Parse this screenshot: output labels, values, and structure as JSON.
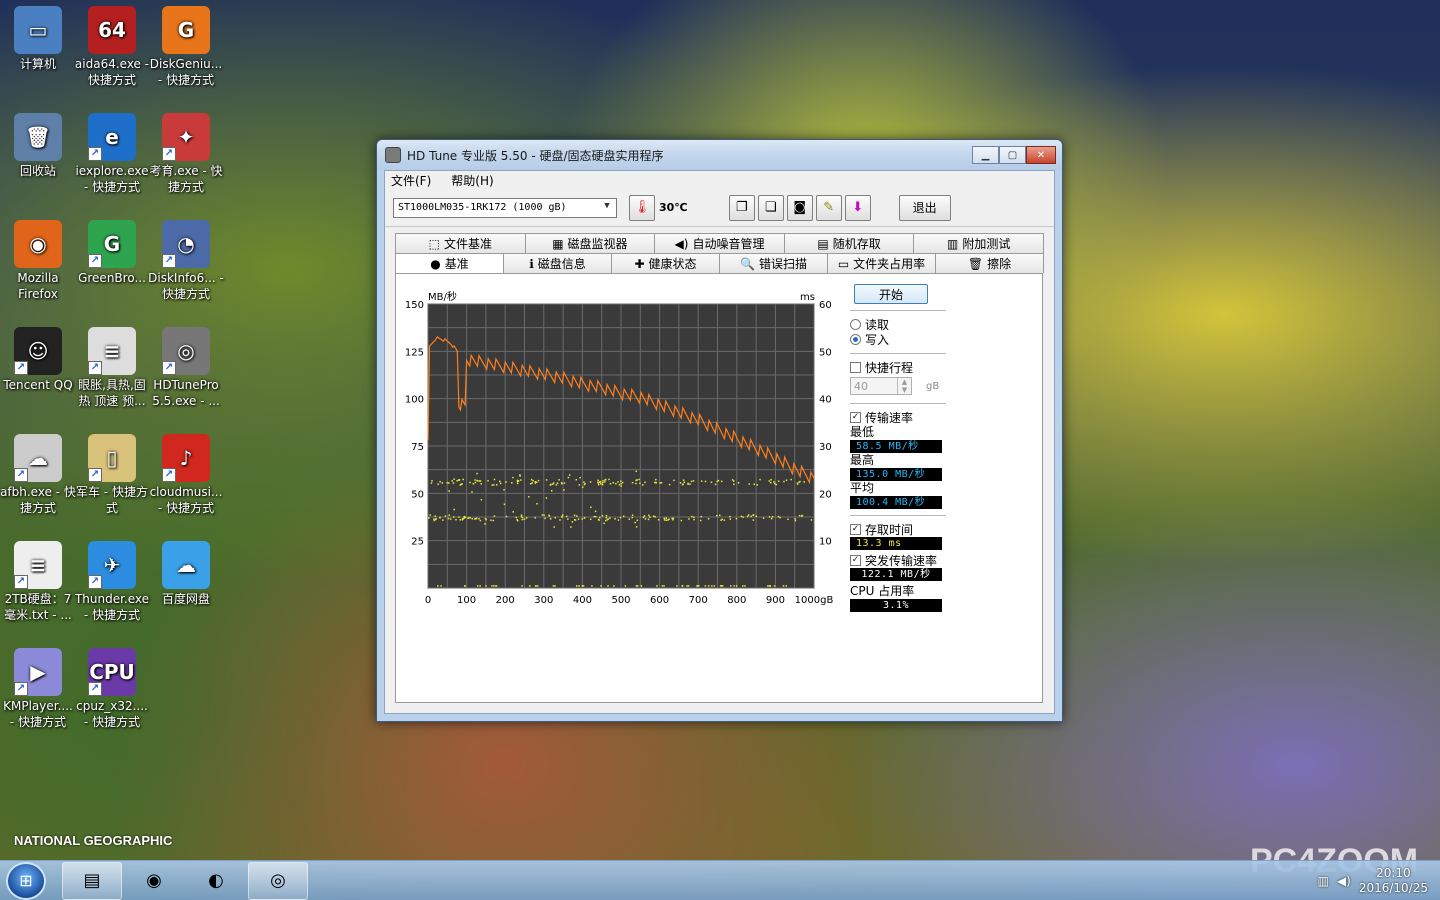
{
  "desktop": {
    "icons": [
      {
        "label": "计算机",
        "glyph": "▭",
        "color": "#4a7fc1"
      },
      {
        "label": "aida64.exe - 快捷方式",
        "glyph": "64",
        "color": "#b41f1f"
      },
      {
        "label": "DiskGeniu... - 快捷方式",
        "glyph": "G",
        "color": "#e8751a"
      },
      {
        "label": "回收站",
        "glyph": "🗑",
        "color": "#5d7fa8"
      },
      {
        "label": "iexplore.exe - 快捷方式",
        "glyph": "e",
        "color": "#1e6fc9"
      },
      {
        "label": "考育.exe - 快捷方式",
        "glyph": "✦",
        "color": "#c93a3a"
      },
      {
        "label": "Mozilla Firefox",
        "glyph": "◉",
        "color": "#e0641a"
      },
      {
        "label": "GreenBro...",
        "glyph": "G",
        "color": "#2ea44f"
      },
      {
        "label": "DiskInfo6... - 快捷方式",
        "glyph": "◔",
        "color": "#4c6aa8"
      },
      {
        "label": "Tencent QQ",
        "glyph": "☺",
        "color": "#222222"
      },
      {
        "label": "眼胀,具热,固热 顶速 预...",
        "glyph": "≡",
        "color": "#dddddd"
      },
      {
        "label": "HDTunePro 5.5.exe - ...",
        "glyph": "◎",
        "color": "#777777"
      },
      {
        "label": "afbh.exe - 快捷方式",
        "glyph": "☁",
        "color": "#cccccc"
      },
      {
        "label": "军车 - 快捷方式",
        "glyph": "▯",
        "color": "#d9c27a"
      },
      {
        "label": "cloudmusi... - 快捷方式",
        "glyph": "♪",
        "color": "#d0281e"
      },
      {
        "label": "2TB硬盘：7毫米.txt - ...",
        "glyph": "≡",
        "color": "#eeeeee"
      },
      {
        "label": "Thunder.exe - 快捷方式",
        "glyph": "✈",
        "color": "#2c8de0"
      },
      {
        "label": "百度网盘",
        "glyph": "☁",
        "color": "#3aa0e8"
      },
      {
        "label": "KMPlayer.... - 快捷方式",
        "glyph": "▶",
        "color": "#8a8ad8"
      },
      {
        "label": "cpuz_x32.... - 快捷方式",
        "glyph": "CPU",
        "color": "#6a3aa8"
      }
    ],
    "natgeo": "NATIONAL GEOGRAPHIC",
    "watermark": "PC4ZOOM"
  },
  "window": {
    "title": "HD Tune 专业版 5.50 - 硬盘/固态硬盘实用程序",
    "menu": {
      "file": "文件(F)",
      "help": "帮助(H)"
    },
    "drive": "ST1000LM035-1RK172 (1000 gB)",
    "temperature": "30℃",
    "exit_label": "退出",
    "tabs_row1": [
      {
        "label": "文件基准",
        "icon": "⬚"
      },
      {
        "label": "磁盘监视器",
        "icon": "▦"
      },
      {
        "label": "自动噪音管理",
        "icon": "◀)"
      },
      {
        "label": "随机存取",
        "icon": "▤"
      },
      {
        "label": "附加测试",
        "icon": "▥"
      }
    ],
    "tabs_row2": [
      {
        "label": "基准",
        "icon": "●"
      },
      {
        "label": "磁盘信息",
        "icon": "ℹ"
      },
      {
        "label": "健康状态",
        "icon": "✚"
      },
      {
        "label": "错误扫描",
        "icon": "🔍"
      },
      {
        "label": "文件夹占用率",
        "icon": "▭"
      },
      {
        "label": "擦除",
        "icon": "🗑"
      }
    ],
    "side": {
      "start": "开始",
      "read": "读取",
      "write": "写入",
      "short_stroke": "快捷行程",
      "short_value": "40",
      "short_unit": "gB",
      "transfer_rate": "传输速率",
      "min_label": "最低",
      "min_value": "58.5 MB/秒",
      "max_label": "最高",
      "max_value": "135.0 MB/秒",
      "avg_label": "平均",
      "avg_value": "100.4 MB/秒",
      "access_time": "存取时间",
      "access_value": "13.3 ms",
      "burst_rate": "突发传输速率",
      "burst_value": "122.1 MB/秒",
      "cpu_label": "CPU 占用率",
      "cpu_value": "3.1%"
    }
  },
  "taskbar": {
    "items": [
      {
        "name": "explorer-taskbar",
        "glyph": "▤"
      },
      {
        "name": "eye-app-taskbar",
        "glyph": "◉"
      },
      {
        "name": "firefox-taskbar",
        "glyph": "◐"
      },
      {
        "name": "hdtune-taskbar",
        "glyph": "◎"
      }
    ],
    "time": "20:10",
    "date": "2016/10/25"
  },
  "chart_data": {
    "type": "line",
    "ylabel_left": "MB/秒",
    "ylabel_right": "ms",
    "xlabel": "gB",
    "xlim": [
      0,
      1000
    ],
    "ylim_left": [
      0,
      150
    ],
    "ylim_right": [
      0,
      60
    ],
    "x_ticks": [
      "0",
      "100",
      "200",
      "300",
      "400",
      "500",
      "600",
      "700",
      "800",
      "900",
      "1000gB"
    ],
    "y_ticks_left": [
      "25",
      "50",
      "75",
      "100",
      "125",
      "150"
    ],
    "y_ticks_right": [
      "10",
      "20",
      "30",
      "40",
      "50",
      "60"
    ],
    "grid": true,
    "series": [
      {
        "color": "#ff7f1e",
        "x": [
          0,
          20,
          40,
          60,
          80,
          100,
          150,
          200,
          250,
          300,
          350,
          400,
          450,
          500,
          550,
          600,
          650,
          700,
          750,
          800,
          850,
          900,
          950,
          1000
        ],
        "values": [
          127,
          133,
          132,
          130,
          125,
          124,
          122,
          120,
          118,
          116,
          114,
          111,
          109,
          106,
          104,
          100,
          96,
          92,
          87,
          82,
          77,
          72,
          66,
          61
        ]
      }
    ],
    "scatter_bands": [
      {
        "color": "#e8e83a",
        "center": 22.5,
        "axis": "right"
      },
      {
        "color": "#e8e83a",
        "center": 15.0,
        "axis": "right"
      }
    ]
  }
}
